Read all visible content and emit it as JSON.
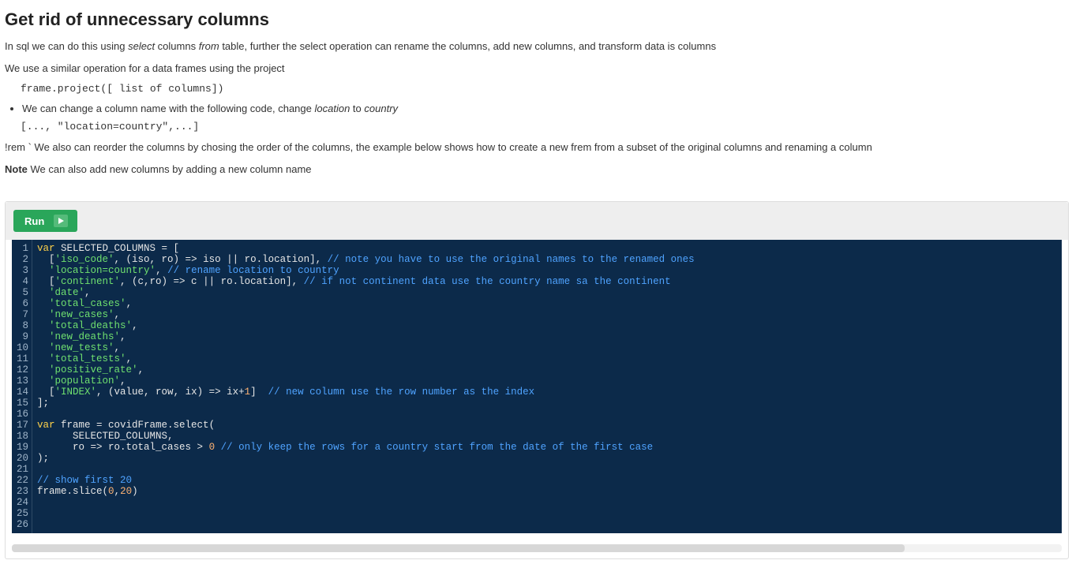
{
  "heading": "Get rid of unnecessary columns",
  "para1_a": "In sql we can do this using ",
  "para1_select": "select",
  "para1_b": " columns ",
  "para1_from": "from",
  "para1_c": " table, further the select operation can rename the columns, add new columns, and transform data is columns",
  "para2": "We use a similar operation for a data frames using the project",
  "codeblock1": "frame.project([ list of columns])",
  "bullet1_a": "We can change a column name with the following code, change ",
  "bullet1_loc": "location",
  "bullet1_b": " to ",
  "bullet1_country": "country",
  "codeblock2": "[..., \"location=country\",...]",
  "para3": "!rem ` We also can reorder the columns by chosing the order of the columns, the example below shows how to create a new frem from a subset of the original columns and renaming a column",
  "note_label": "Note",
  "note_text": " We can also add new columns by adding a new column name",
  "run_label": "Run",
  "code_html": [
    "<span class='kw'>var</span><span class='pln'> SELECTED_COLUMNS = [</span>",
    "<span class='pln'>  [</span><span class='str'>'iso_code'</span><span class='pln'>, (iso, ro) =&gt; iso || ro.location], </span><span class='com'>// note you have to use the original names to the renamed ones</span>",
    "<span class='pln'>  </span><span class='str'>'location=country'</span><span class='pln'>, </span><span class='com'>// rename location to country</span>",
    "<span class='pln'>  [</span><span class='str'>'continent'</span><span class='pln'>, (c,ro) =&gt; c || ro.location], </span><span class='com'>// if not continent data use the country name sa the continent</span>",
    "<span class='pln'>  </span><span class='str'>'date'</span><span class='pln'>,</span>",
    "<span class='pln'>  </span><span class='str'>'total_cases'</span><span class='pln'>,</span>",
    "<span class='pln'>  </span><span class='str'>'new_cases'</span><span class='pln'>,</span>",
    "<span class='pln'>  </span><span class='str'>'total_deaths'</span><span class='pln'>,</span>",
    "<span class='pln'>  </span><span class='str'>'new_deaths'</span><span class='pln'>,</span>",
    "<span class='pln'>  </span><span class='str'>'new_tests'</span><span class='pln'>,</span>",
    "<span class='pln'>  </span><span class='str'>'total_tests'</span><span class='pln'>,</span>",
    "<span class='pln'>  </span><span class='str'>'positive_rate'</span><span class='pln'>,</span>",
    "<span class='pln'>  </span><span class='str'>'population'</span><span class='pln'>,</span>",
    "<span class='pln'>  [</span><span class='str'>'INDEX'</span><span class='pln'>, (value, row, ix) =&gt; ix+</span><span class='num'>1</span><span class='pln'>]  </span><span class='com'>// new column use the row number as the index</span>",
    "<span class='pln'>];</span>",
    "",
    "<span class='kw'>var</span><span class='pln'> frame = covidFrame.select(</span>",
    "<span class='pln'>      SELECTED_COLUMNS,</span>",
    "<span class='pln'>      ro =&gt; ro.total_cases &gt; </span><span class='num'>0</span><span class='pln'> </span><span class='com'>// only keep the rows for a country start from the date of the first case</span>",
    "<span class='pln'>);</span>",
    "",
    "<span class='com'>// show first 20</span>",
    "<span class='pln'>frame.slice(</span><span class='num'>0</span><span class='pln'>,</span><span class='num'>20</span><span class='pln'>)</span>",
    "",
    "",
    ""
  ]
}
